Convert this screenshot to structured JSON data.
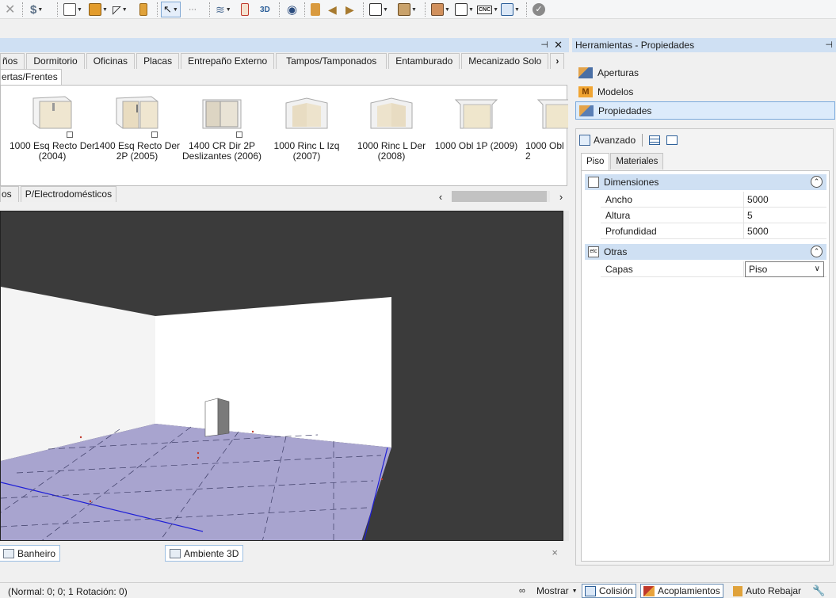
{
  "toolbar": {
    "icons": [
      "close-icon",
      "price-icon",
      "layout-icon",
      "group-icon",
      "curve-icon",
      "fitting-icon",
      "pointer-icon",
      "measure-icon",
      "layers-icon",
      "dimension-icon",
      "view-3d-icon",
      "eye-icon",
      "paint-icon",
      "back-icon",
      "forward-icon",
      "frame-icon",
      "box-icon",
      "print-icon",
      "report-icon",
      "cnc-icon",
      "chart-icon",
      "check-icon"
    ],
    "view_3d_label": "3D",
    "cnc_label": "CNC"
  },
  "library": {
    "category_tabs": [
      "ños",
      "Dormitorio",
      "Oficinas",
      "Placas",
      "Entrepaño Externo",
      "Tampos/Tamponados",
      "Entamburado",
      "Mecanizado Solo"
    ],
    "more_tabs_label": "›",
    "sub_tabs": [
      "ertas/Frentes"
    ],
    "items": [
      {
        "name": "1000 Esq Recto Der (2004)"
      },
      {
        "name": "1400 Esq Recto Der 2P (2005)"
      },
      {
        "name": "1400 CR Dir 2P Deslizantes (2006)"
      },
      {
        "name": "1000 Rinc L Izq (2007)"
      },
      {
        "name": "1000 Rinc L Der (2008)"
      },
      {
        "name": "1000 Obl 1P (2009)"
      },
      {
        "name": "1000 Obl 2"
      }
    ],
    "group_tabs": [
      "os",
      "P/Electrodomésticos"
    ],
    "scroll_left": "‹",
    "scroll_right": "›"
  },
  "document_tabs": [
    {
      "label": "Banheiro"
    },
    {
      "label": "Ambiente 3D"
    }
  ],
  "doc_close": "×",
  "dock_pin": "⊣",
  "dock_close": "✕",
  "right_panel": {
    "title": "Herramientas - Propiedades",
    "pin": "⊣",
    "accordion": [
      {
        "label": "Aperturas",
        "icon": "hammer-icon"
      },
      {
        "label": "Modelos",
        "icon": "models-icon"
      },
      {
        "label": "Propiedades",
        "icon": "properties-icon"
      }
    ],
    "advanced_label": "Avanzado",
    "tabs": [
      "Piso",
      "Materiales"
    ],
    "categories": [
      {
        "name": "Dimensiones",
        "rows": [
          {
            "label": "Ancho",
            "value": "5000"
          },
          {
            "label": "Altura",
            "value": "5"
          },
          {
            "label": "Profundidad",
            "value": "5000"
          }
        ]
      },
      {
        "name": "Otras",
        "icon_text": "etc",
        "rows": [
          {
            "label": "Capas",
            "value": "Piso"
          }
        ]
      }
    ]
  },
  "status": {
    "text": "(Normal: 0; 0; 1 Rotación: 0)",
    "buttons": [
      {
        "label": "Mostrar",
        "icon": "glasses-icon"
      },
      {
        "label": "Colisión",
        "icon": "collision-icon"
      },
      {
        "label": "Acoplamientos",
        "icon": "couplings-icon"
      },
      {
        "label": "Auto Rebajar",
        "icon": "auto-lower-icon"
      }
    ]
  }
}
